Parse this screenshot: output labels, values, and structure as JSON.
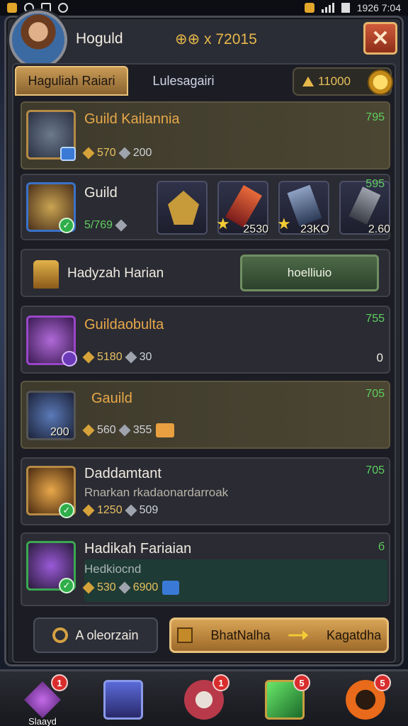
{
  "status_bar": {
    "time": "1926 7:04"
  },
  "header": {
    "player_name": "Hoguld",
    "currency": "⊕⊕ x 72015",
    "close_label": "✕"
  },
  "tabs": [
    {
      "label": "Haguliah Raiari"
    },
    {
      "label": "Lulesagairi"
    }
  ],
  "gold": {
    "amount": "11000"
  },
  "cards": [
    {
      "title": "Guild Kailannia",
      "gold_stat": "570",
      "silver_stat": "200",
      "right_value": "795"
    },
    {
      "title": "Guild",
      "stat": "5/769",
      "right_value": "595",
      "mini_items": [
        {
          "value": ""
        },
        {
          "value": "2530"
        },
        {
          "value": "23KO"
        },
        {
          "value": "2.60"
        }
      ]
    },
    {
      "title": "Hadyzah Harian",
      "button_label": "hoelliuio"
    },
    {
      "title": "Guildaobulta",
      "gold_stat": "5180",
      "silver_stat": "30",
      "right_value": "755",
      "right_small": "0"
    },
    {
      "title": "Gauild",
      "gold_stat": "560",
      "silver_stat": "355",
      "right_value": "705",
      "tile_value": "200"
    },
    {
      "title": "Daddamtant",
      "subtitle": "Rnarkan rkadaonardarroak",
      "gold_stat": "1250",
      "silver_stat": "509",
      "right_value": "705"
    },
    {
      "title": "Hadikah Fariaian",
      "subtitle": "Hedkiocnd",
      "gold_stat": "530",
      "silver_stat": "6900",
      "right_value": "б"
    }
  ],
  "bottom_buttons": {
    "left_label": "A oleorzain",
    "mid_label": "BhatNalha",
    "right_label": "Kagatdha"
  },
  "nav": [
    {
      "label": "Slaayd",
      "badge": "1"
    },
    {
      "label": "",
      "badge": ""
    },
    {
      "label": "",
      "badge": "1"
    },
    {
      "label": "",
      "badge": "5"
    },
    {
      "label": "",
      "badge": "5"
    }
  ],
  "colors": {
    "accent_gold": "#e7b84a",
    "title_orange": "#e8a84a",
    "positive_green": "#5fcf5f",
    "close_red": "#d05a3a"
  }
}
